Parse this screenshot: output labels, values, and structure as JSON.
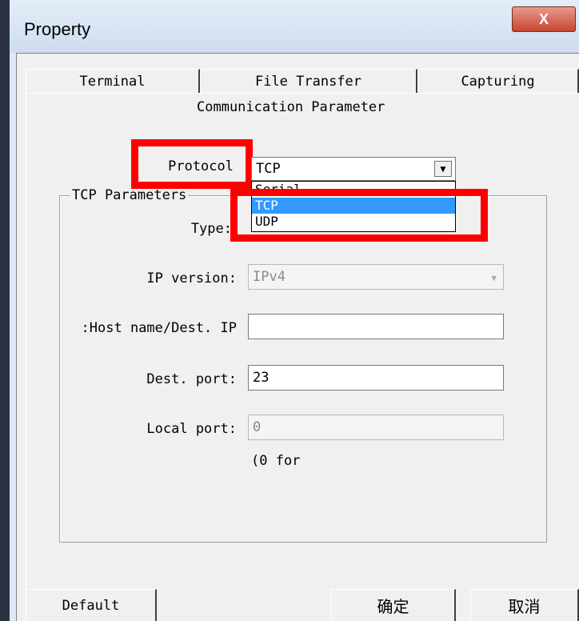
{
  "window": {
    "title": "Property",
    "close_glyph": "X"
  },
  "tabs": [
    {
      "label": "Terminal"
    },
    {
      "label": "File Transfer"
    },
    {
      "label": "Capturing"
    }
  ],
  "panel": {
    "title": "Communication Parameter"
  },
  "protocol": {
    "label": "Protocol",
    "value": "TCP",
    "options": [
      "Serial",
      "TCP",
      "UDP"
    ],
    "highlighted_option": "TCP"
  },
  "tcp_group": {
    "label": "TCP Parameters",
    "type_label": "Type:",
    "ip_version_label": "IP version:",
    "ip_version_value": "IPv4",
    "dest_host_label": "Host name/Dest. IP:",
    "dest_host_value": "",
    "dest_port_label": "Dest. port:",
    "dest_port_value": "23",
    "local_port_label": "Local port:",
    "local_port_value": "0",
    "local_port_hint": "(0 for"
  },
  "buttons": {
    "default": "Default",
    "ok": "确定",
    "cancel": "取消"
  },
  "icons": {
    "dropdown": "chevron-down-icon",
    "close": "close-icon"
  },
  "colors": {
    "highlight": "#ff0000",
    "selection": "#3399ff"
  }
}
